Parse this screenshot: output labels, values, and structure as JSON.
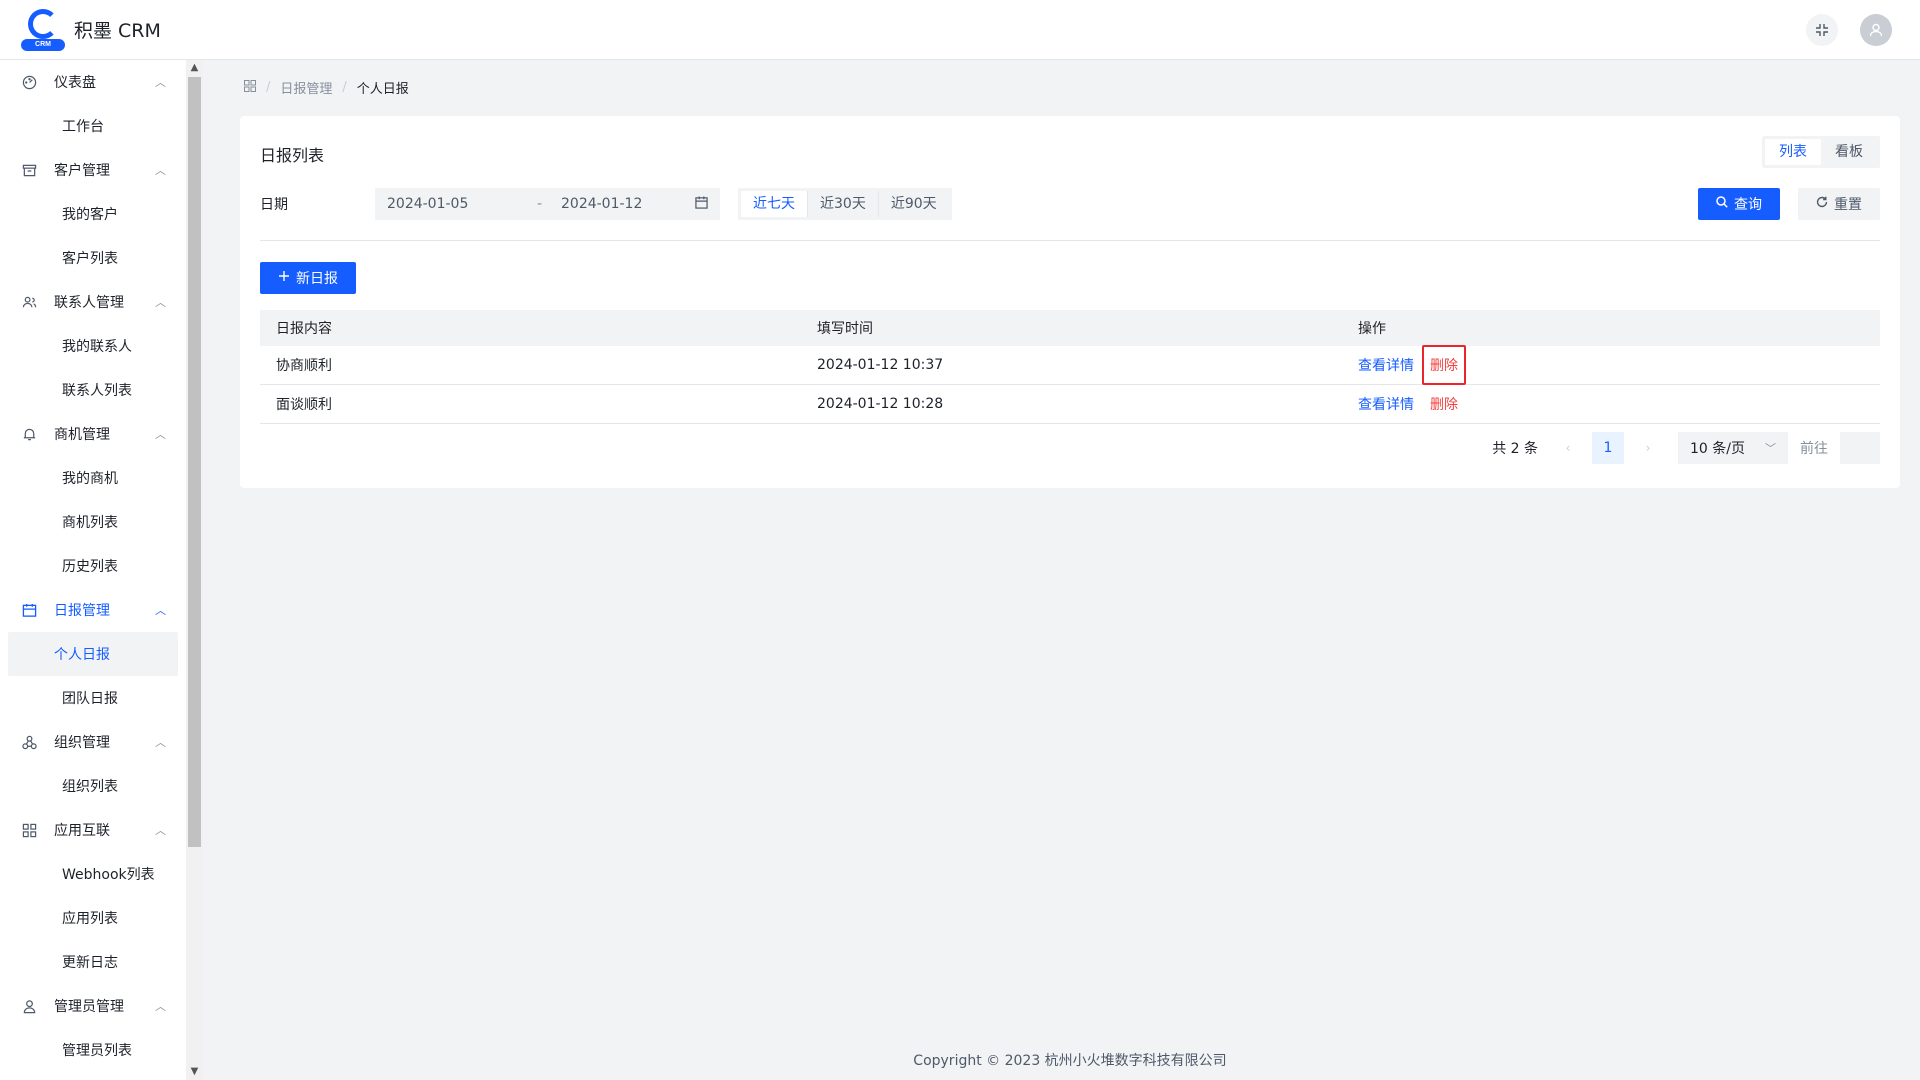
{
  "app": {
    "logo_badge": "CRM",
    "name": "积墨 CRM",
    "fullscreen_icon": "fullscreen-exit-icon",
    "avatar_icon": "user-icon"
  },
  "sidebar": {
    "groups": [
      {
        "label": "仪表盘",
        "icon": "dashboard-icon",
        "items": [
          "工作台"
        ]
      },
      {
        "label": "客户管理",
        "icon": "archive-icon",
        "items": [
          "我的客户",
          "客户列表"
        ]
      },
      {
        "label": "联系人管理",
        "icon": "contacts-icon",
        "items": [
          "我的联系人",
          "联系人列表"
        ]
      },
      {
        "label": "商机管理",
        "icon": "bell-icon",
        "items": [
          "我的商机",
          "商机列表",
          "历史列表"
        ]
      },
      {
        "label": "日报管理",
        "icon": "calendar-icon",
        "items": [
          "个人日报",
          "团队日报"
        ],
        "active": true,
        "active_item": "个人日报"
      },
      {
        "label": "组织管理",
        "icon": "organization-icon",
        "items": [
          "组织列表"
        ]
      },
      {
        "label": "应用互联",
        "icon": "apps-icon",
        "items": [
          "Webhook列表",
          "应用列表",
          "更新日志"
        ]
      },
      {
        "label": "管理员管理",
        "icon": "admin-user-icon",
        "items": [
          "管理员列表"
        ]
      }
    ]
  },
  "breadcrumb": {
    "home_icon": "apps-grid-icon",
    "items": [
      "日报管理",
      "个人日报"
    ]
  },
  "card": {
    "title": "日报列表",
    "view_switch": [
      "列表",
      "看板"
    ],
    "filter": {
      "label": "日期",
      "start": "2024-01-05",
      "separator": "-",
      "end": "2024-01-12",
      "quick": [
        "近七天",
        "近30天",
        "近90天"
      ]
    },
    "search_label": "查询",
    "reset_label": "重置",
    "new_label": "新日报"
  },
  "table": {
    "headers": [
      "日报内容",
      "填写时间",
      "操作"
    ],
    "rows": [
      {
        "content": "协商顺利",
        "time": "2024-01-12 10:37",
        "view": "查看详情",
        "delete": "删除"
      },
      {
        "content": "面谈顺利",
        "time": "2024-01-12 10:28",
        "view": "查看详情",
        "delete": "删除"
      }
    ]
  },
  "pagination": {
    "total": "共 2 条",
    "current": "1",
    "page_size": "10 条/页",
    "goto_label": "前往"
  },
  "footer": "Copyright © 2023 杭州小火堆数字科技有限公司",
  "colors": {
    "primary": "#165dff",
    "danger": "#f53f3f",
    "highlight": "#e8262c"
  }
}
